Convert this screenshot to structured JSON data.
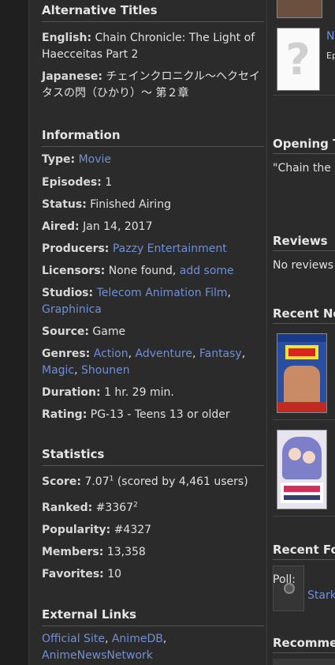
{
  "alt_titles": {
    "heading": "Alternative Titles",
    "english_label": "English:",
    "english_value": "Chain Chronicle: The Light of Haecceitas Part 2",
    "japanese_label": "Japanese:",
    "japanese_value": "チェインクロニクル〜ヘクセイタスの閃（ひかり）〜 第２章"
  },
  "information": {
    "heading": "Information",
    "type_label": "Type:",
    "type_value": "Movie",
    "episodes_label": "Episodes:",
    "episodes_value": "1",
    "status_label": "Status:",
    "status_value": "Finished Airing",
    "aired_label": "Aired:",
    "aired_value": "Jan 14, 2017",
    "producers_label": "Producers:",
    "producers_value": "Pazzy Entertainment",
    "licensors_label": "Licensors:",
    "licensors_value": "None found,",
    "licensors_link": "add some",
    "studios_label": "Studios:",
    "studios_1": "Telecom Animation Film",
    "studios_2": "Graphinica",
    "source_label": "Source:",
    "source_value": "Game",
    "genres_label": "Genres:",
    "genres": [
      "Action",
      "Adventure",
      "Fantasy",
      "Magic",
      "Shounen"
    ],
    "duration_label": "Duration:",
    "duration_value": "1 hr. 29 min.",
    "rating_label": "Rating:",
    "rating_value": "PG-13 - Teens 13 or older"
  },
  "statistics": {
    "heading": "Statistics",
    "score_label": "Score:",
    "score_value": "7.07",
    "score_note": "1",
    "score_users": "(scored by 4,461 users)",
    "ranked_label": "Ranked:",
    "ranked_value": "#3367",
    "ranked_note": "2",
    "popularity_label": "Popularity:",
    "popularity_value": "#4327",
    "members_label": "Members:",
    "members_value": "13,358",
    "favorites_label": "Favorites:",
    "favorites_value": "10"
  },
  "external_links": {
    "heading": "External Links",
    "links": [
      "Official Site",
      "AnimeDB",
      "AnimeNewsNetwork"
    ]
  },
  "right": {
    "related_link": "N",
    "related_sub": "Ep",
    "opening_heading": "Opening T",
    "opening_text": "\"Chain the",
    "reviews_heading": "Reviews",
    "reviews_text": "No reviews",
    "recent_news_heading": "Recent Ne",
    "recent_forum_heading": "Recent Fo",
    "forum_poll": "Poll:",
    "forum_link": "Stark",
    "recommend_heading": "Recomme"
  }
}
